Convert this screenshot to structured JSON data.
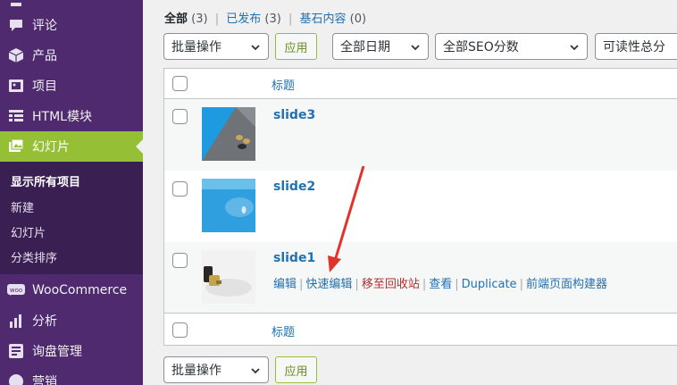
{
  "sidebar": {
    "items": [
      {
        "label": "",
        "icon": "pin-icon"
      },
      {
        "label": "评论",
        "icon": "comment-icon"
      },
      {
        "label": "产品",
        "icon": "box-icon"
      },
      {
        "label": "项目",
        "icon": "portfolio-icon"
      },
      {
        "label": "HTML模块",
        "icon": "grid-icon"
      },
      {
        "label": "幻灯片",
        "icon": "slides-icon"
      },
      {
        "label": "WooCommerce",
        "icon": "woo-icon"
      },
      {
        "label": "分析",
        "icon": "bar-chart-icon"
      },
      {
        "label": "询盘管理",
        "icon": "inquiry-icon"
      },
      {
        "label": "营销",
        "icon": "megaphone-icon"
      }
    ],
    "submenu": [
      "显示所有项目",
      "新建",
      "幻灯片",
      "分类排序"
    ],
    "accent_color": "#95c036",
    "background_color": "#4f2a6f"
  },
  "status_links": {
    "all_label": "全部",
    "all_count": "(3)",
    "published_label": "已发布",
    "published_count": "(3)",
    "cornerstone_label": "基石内容",
    "cornerstone_count": "(0)",
    "separator": "|"
  },
  "filters": {
    "bulk_action": "批量操作",
    "apply": "应用",
    "date": "全部日期",
    "seo": "全部SEO分数",
    "readability": "可读性总分"
  },
  "table": {
    "column_title": "标题",
    "rows": [
      {
        "title": "slide3"
      },
      {
        "title": "slide2"
      },
      {
        "title": "slide1"
      }
    ],
    "row_actions": [
      "编辑",
      "快速编辑",
      "移至回收站",
      "查看",
      "Duplicate",
      "前端页面构建器"
    ]
  },
  "bottom_filters": {
    "bulk_action": "批量操作",
    "apply": "应用"
  }
}
